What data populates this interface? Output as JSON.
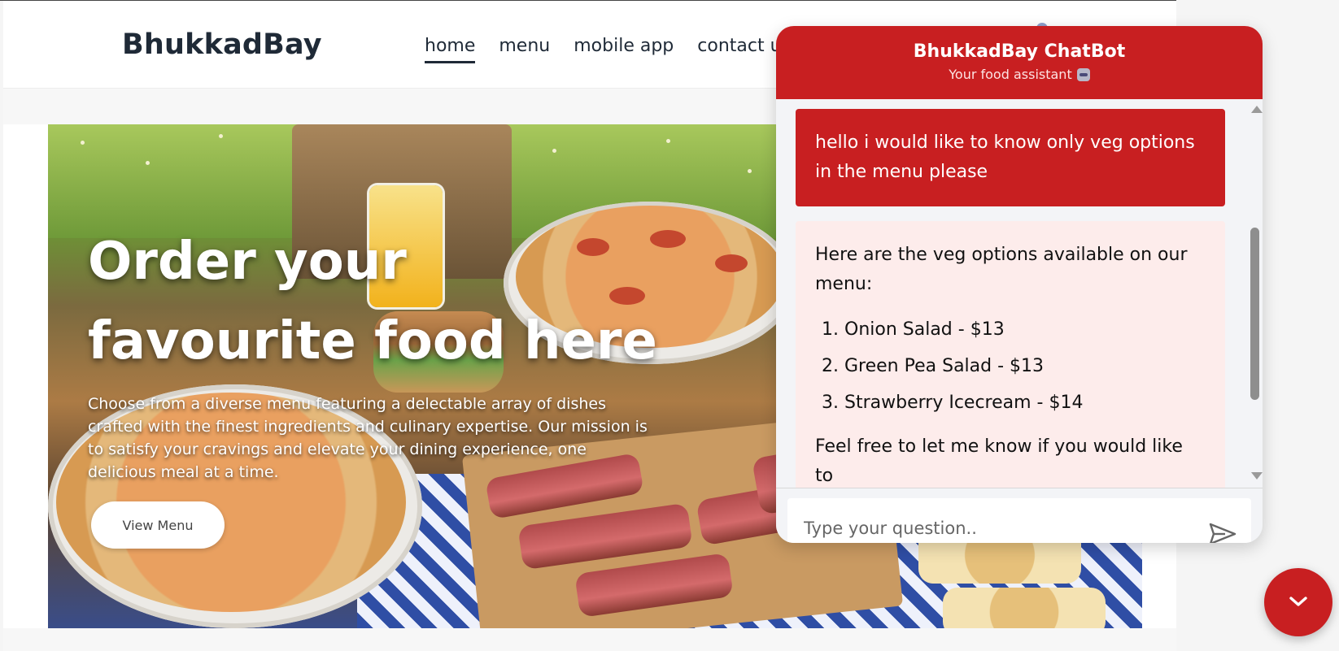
{
  "header": {
    "logo": "BhukkadBay",
    "nav": [
      {
        "label": "home",
        "active": true
      },
      {
        "label": "menu",
        "active": false
      },
      {
        "label": "mobile app",
        "active": false
      },
      {
        "label": "contact us",
        "active": false
      }
    ]
  },
  "hero": {
    "title": "Order your favourite food here",
    "description": "Choose from a diverse menu featuring a delectable array of dishes crafted with the finest ingredients and culinary expertise. Our mission is to satisfy your cravings and elevate your dining experience, one delicious meal at a time.",
    "button_label": "View Menu"
  },
  "chatbot": {
    "title": "BhukkadBay ChatBot",
    "subtitle": "Your food assistant",
    "user_message": "hello i would like to know only veg options in the menu please",
    "bot_intro": "Here are the veg options available on our menu:",
    "bot_items": [
      "Onion Salad - $13",
      "Green Pea Salad - $13",
      "Strawberry Icecream - $14"
    ],
    "bot_tail": "Feel free to let me know if you would like to",
    "input_placeholder": "Type your question.."
  },
  "colors": {
    "brand_red": "#c81f21",
    "bot_bubble": "#fdeceb",
    "text_dark": "#1f2a37"
  }
}
